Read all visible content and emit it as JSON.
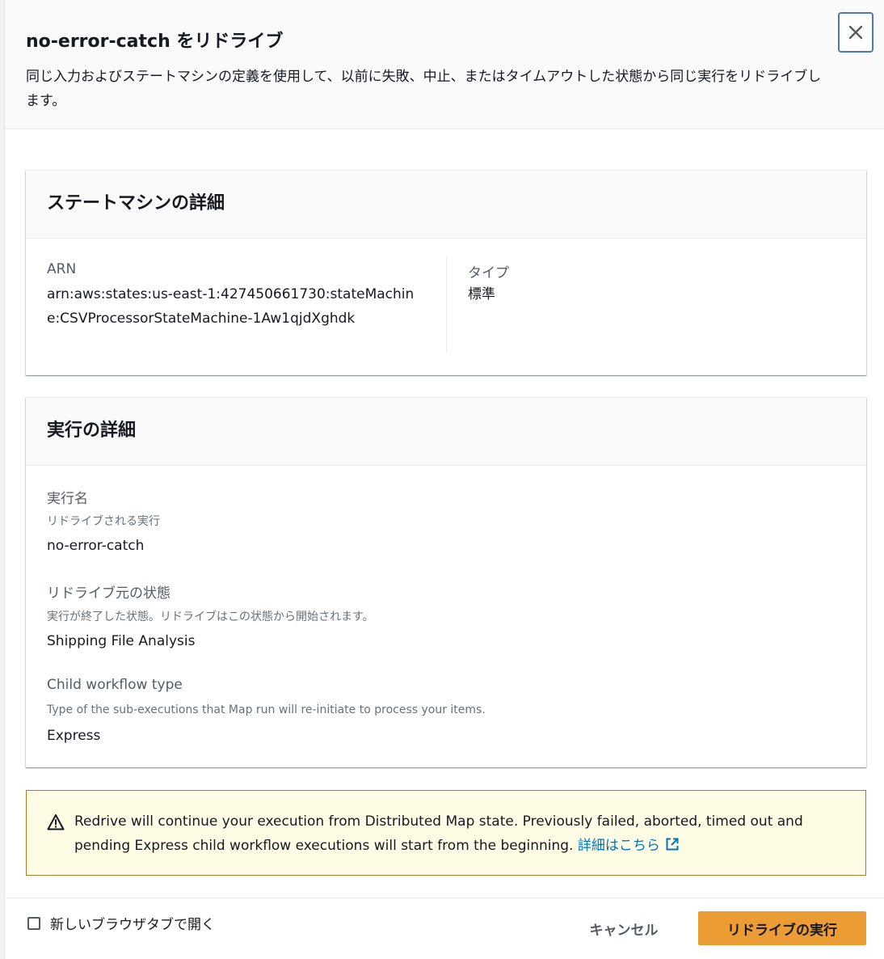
{
  "modal": {
    "title": "no-error-catch をリドライブ",
    "description": "同じ入力およびステートマシンの定義を使用して、以前に失敗、中止、またはタイムアウトした状態から同じ実行をリドライブします。",
    "close_icon": "close-icon"
  },
  "state_machine_details": {
    "title": "ステートマシンの詳細",
    "arn_label": "ARN",
    "arn_value": "arn:aws:states:us-east-1:427450661730:stateMachine:CSVProcessorStateMachine-1Aw1qjdXghdk",
    "type_label": "タイプ",
    "type_value": "標準"
  },
  "execution_details": {
    "title": "実行の詳細",
    "name_label": "実行名",
    "name_desc": "リドライブされる実行",
    "name_value": "no-error-catch",
    "state_label": "リドライブ元の状態",
    "state_desc": "実行が終了した状態。リドライブはこの状態から開始されます。",
    "state_value": "Shipping File Analysis",
    "child_label": "Child workflow type",
    "child_desc": "Type of the sub-executions that Map run will re-initiate to process your items.",
    "child_value": "Express"
  },
  "alert": {
    "icon": "warning-icon",
    "text": "Redrive will continue your execution from Distributed Map state. Previously failed, aborted, timed out and pending Express child workflow executions will start from the beginning.",
    "link_text": "詳細はこちら",
    "link_icon": "external-link-icon"
  },
  "footer": {
    "checkbox_label": "新しいブラウザタブで開く",
    "cancel_label": "キャンセル",
    "submit_label": "リドライブの実行"
  },
  "colors": {
    "primary": "#ec9c34",
    "link": "#0073bb",
    "close_border": "#4a7ab6",
    "alert_bg": "#fffce6",
    "alert_border": "#a87a2a"
  }
}
